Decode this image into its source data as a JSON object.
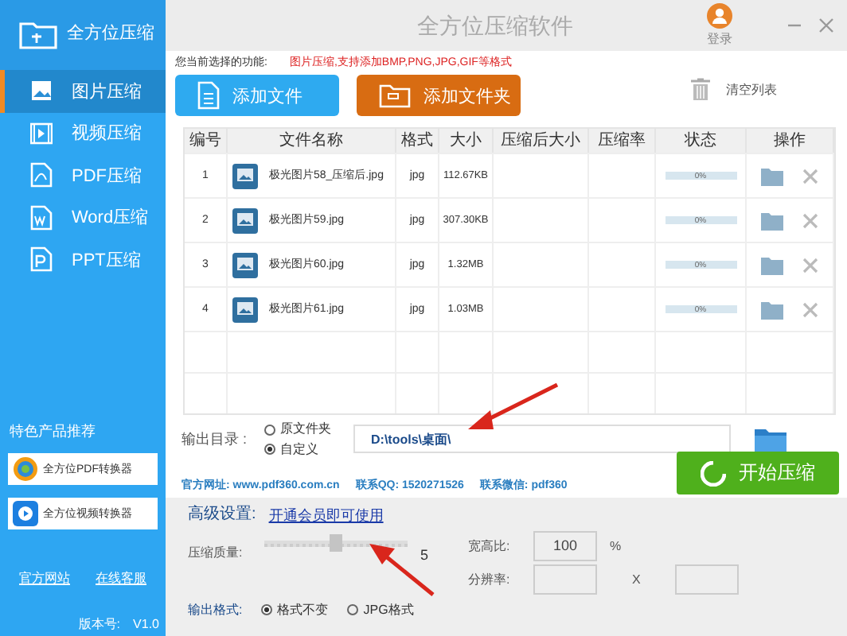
{
  "app": {
    "name": "全方位压缩",
    "title": "全方位压缩软件",
    "login": "登录"
  },
  "sidebar": {
    "items": [
      {
        "label": "图片压缩",
        "kind": "image",
        "selected": true
      },
      {
        "label": "视频压缩",
        "kind": "video",
        "selected": false
      },
      {
        "label": "PDF压缩",
        "kind": "pdf",
        "selected": false
      },
      {
        "label": "Word压缩",
        "kind": "word",
        "selected": false
      },
      {
        "label": "PPT压缩",
        "kind": "ppt",
        "selected": false
      }
    ],
    "featured_title": "特色产品推荐",
    "products": [
      {
        "label": "全方位PDF转换器",
        "kind": "pdf"
      },
      {
        "label": "全方位视频转换器",
        "kind": "video"
      }
    ],
    "links": [
      "官方网站",
      "在线客服"
    ],
    "version_label": "版本号:",
    "version": "V1.0"
  },
  "function": {
    "label": "您当前选择的功能:",
    "value": "图片压缩,支持添加BMP,PNG,JPG,GIF等格式"
  },
  "toolbar": {
    "add_file": "添加文件",
    "add_folder": "添加文件夹",
    "clear": "清空列表"
  },
  "table": {
    "columns": [
      "编号",
      "文件名称",
      "格式",
      "大小",
      "压缩后大小",
      "压缩率",
      "状态",
      "操作"
    ],
    "rows": [
      {
        "no": "1",
        "name": "极光图片58_压缩后.jpg",
        "format": "jpg",
        "size": "112.67KB",
        "level": 0,
        "progress": "0%"
      },
      {
        "no": "2",
        "name": "极光图片59.jpg",
        "format": "jpg",
        "size": "307.30KB",
        "level": 0,
        "progress": "0%"
      },
      {
        "no": "3",
        "name": "极光图片60.jpg",
        "format": "jpg",
        "size": "1.32MB",
        "level": 0,
        "progress": "0%"
      },
      {
        "no": "4",
        "name": "极光图片61.jpg",
        "format": "jpg",
        "size": "1.03MB",
        "level": 0,
        "progress": "0%"
      }
    ]
  },
  "output": {
    "label": "输出目录 :",
    "options": [
      {
        "label": "原文件夹",
        "selected": false
      },
      {
        "label": "自定义",
        "selected": true
      }
    ],
    "path": "D:\\tools\\桌面\\"
  },
  "contact": {
    "site": "官方网址: www.pdf360.com.cn",
    "qq": "联系QQ: 1520271526",
    "wechat": "联系微信: pdf360"
  },
  "start_button": "开始压缩",
  "advanced": {
    "label": "高级设置:",
    "link": "开通会员即可使用",
    "quality_label": "压缩质量:",
    "quality": {
      "level": 0.5,
      "value": "5"
    },
    "ratio_label": "宽高比:",
    "ratio": "100",
    "ratio_unit": "%",
    "resolution_label": "分辨率:",
    "x": "X",
    "format_label": "输出格式:",
    "formats": [
      {
        "label": "格式不变",
        "selected": true
      },
      {
        "label": "JPG格式",
        "selected": false
      }
    ]
  }
}
